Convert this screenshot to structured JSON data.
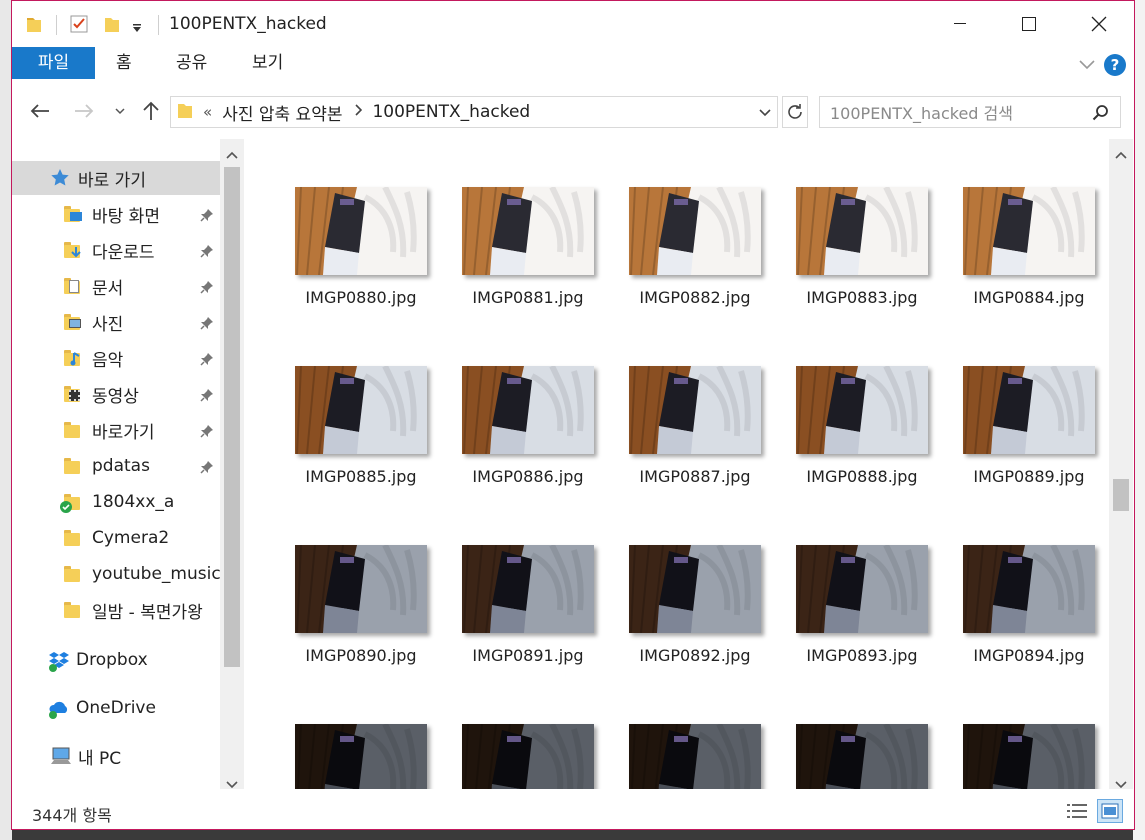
{
  "window": {
    "title": "100PENTX_hacked"
  },
  "ribbon": {
    "tabs": [
      {
        "label": "파일",
        "active": true
      },
      {
        "label": "홈",
        "active": false
      },
      {
        "label": "공유",
        "active": false
      },
      {
        "label": "보기",
        "active": false
      }
    ],
    "help_label": "?"
  },
  "address": {
    "overflow": "«",
    "crumbs": [
      "사진 압축 요약본",
      "100PENTX_hacked"
    ]
  },
  "search": {
    "placeholder": "100PENTX_hacked 검색"
  },
  "sidebar": {
    "quick_access": "바로 가기",
    "items": [
      {
        "label": "바탕 화면",
        "icon": "desktop-folder-icon",
        "pinned": true
      },
      {
        "label": "다운로드",
        "icon": "downloads-folder-icon",
        "pinned": true
      },
      {
        "label": "문서",
        "icon": "documents-folder-icon",
        "pinned": true
      },
      {
        "label": "사진",
        "icon": "pictures-folder-icon",
        "pinned": true
      },
      {
        "label": "음악",
        "icon": "music-folder-icon",
        "pinned": true
      },
      {
        "label": "동영상",
        "icon": "videos-folder-icon",
        "pinned": true
      },
      {
        "label": "바로가기",
        "icon": "folder-icon",
        "pinned": true
      },
      {
        "label": "pdatas",
        "icon": "folder-icon",
        "pinned": true
      },
      {
        "label": "1804xx_a",
        "icon": "synced-folder-icon",
        "pinned": false
      },
      {
        "label": "Cymera2",
        "icon": "folder-icon",
        "pinned": false
      },
      {
        "label": "youtube_music_",
        "icon": "folder-icon",
        "pinned": false
      },
      {
        "label": "일밤 - 복면가왕",
        "icon": "folder-icon",
        "pinned": false
      }
    ],
    "dropbox": "Dropbox",
    "onedrive": "OneDrive",
    "thispc": "내 PC"
  },
  "files": [
    {
      "name": "IMGP0880.jpg",
      "tone": "bright"
    },
    {
      "name": "IMGP0881.jpg",
      "tone": "bright"
    },
    {
      "name": "IMGP0882.jpg",
      "tone": "bright"
    },
    {
      "name": "IMGP0883.jpg",
      "tone": "bright"
    },
    {
      "name": "IMGP0884.jpg",
      "tone": "bright"
    },
    {
      "name": "IMGP0885.jpg",
      "tone": "mid"
    },
    {
      "name": "IMGP0886.jpg",
      "tone": "mid"
    },
    {
      "name": "IMGP0887.jpg",
      "tone": "mid"
    },
    {
      "name": "IMGP0888.jpg",
      "tone": "mid"
    },
    {
      "name": "IMGP0889.jpg",
      "tone": "mid"
    },
    {
      "name": "IMGP0890.jpg",
      "tone": "dark"
    },
    {
      "name": "IMGP0891.jpg",
      "tone": "dark"
    },
    {
      "name": "IMGP0892.jpg",
      "tone": "dark"
    },
    {
      "name": "IMGP0893.jpg",
      "tone": "dark"
    },
    {
      "name": "IMGP0894.jpg",
      "tone": "dark"
    },
    {
      "name": "",
      "tone": "darker"
    },
    {
      "name": "",
      "tone": "darker"
    },
    {
      "name": "",
      "tone": "darker"
    },
    {
      "name": "",
      "tone": "darker"
    },
    {
      "name": "",
      "tone": "darker"
    }
  ],
  "status": {
    "count": "344개 항목"
  },
  "colors": {
    "accent": "#1979ca",
    "window_border": "#c3195d",
    "selection": "#d9d9d9"
  }
}
